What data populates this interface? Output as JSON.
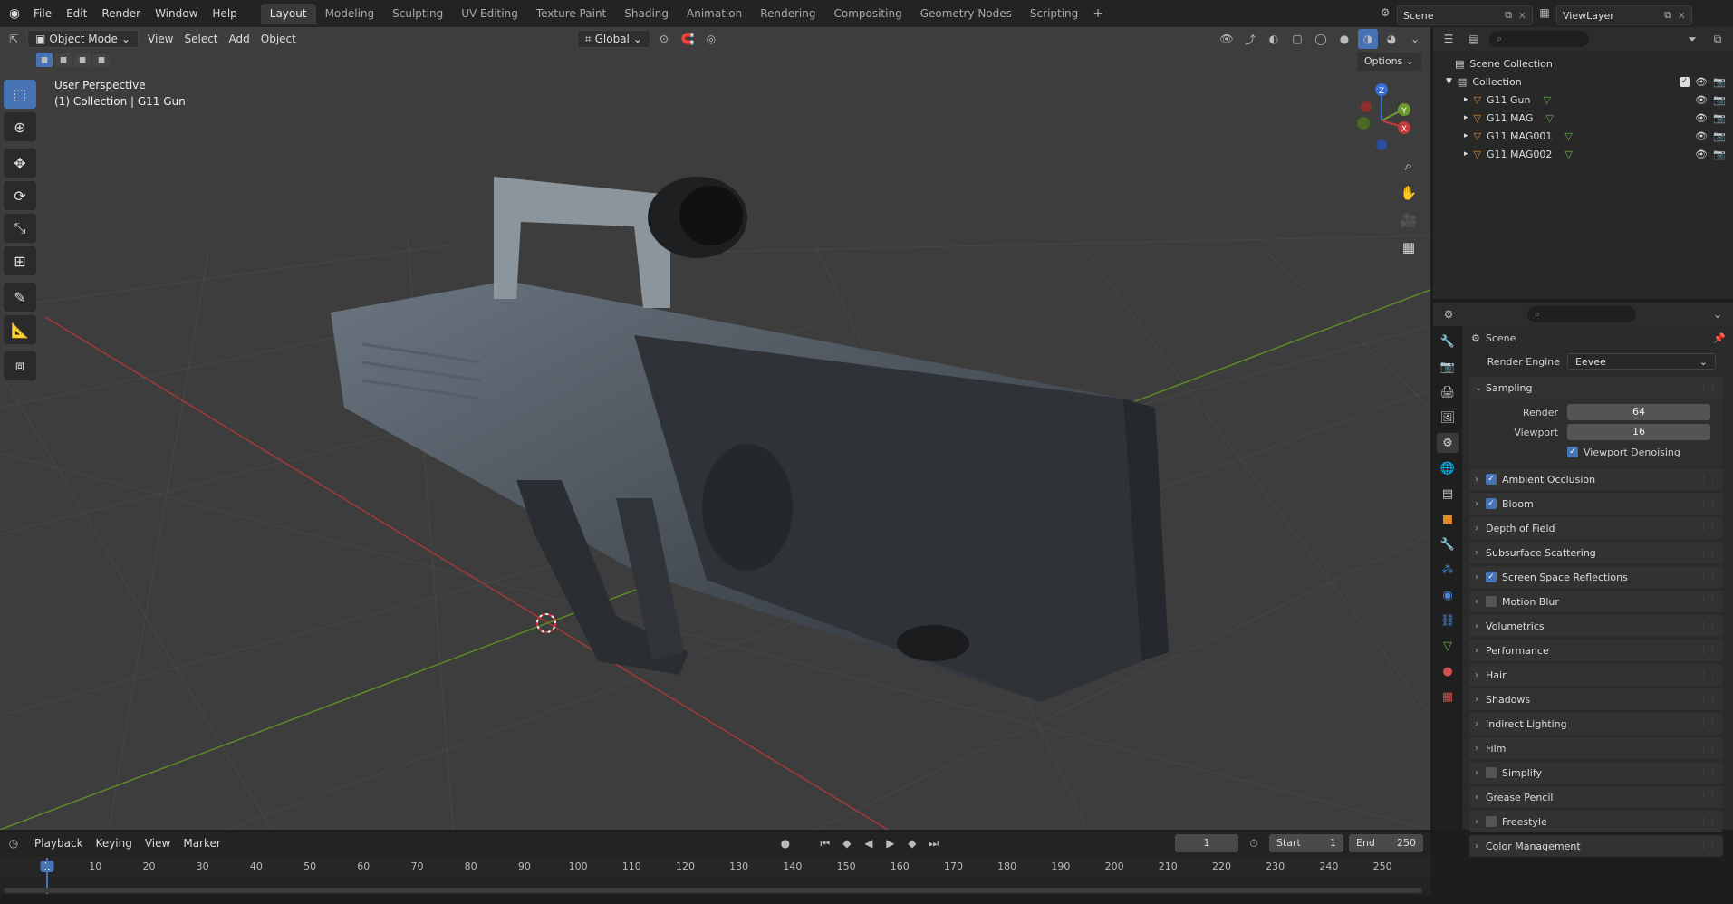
{
  "menubar": {
    "items": [
      "File",
      "Edit",
      "Render",
      "Window",
      "Help"
    ]
  },
  "workspaces": {
    "tabs": [
      "Layout",
      "Modeling",
      "Sculpting",
      "UV Editing",
      "Texture Paint",
      "Shading",
      "Animation",
      "Rendering",
      "Compositing",
      "Geometry Nodes",
      "Scripting"
    ],
    "active": "Layout",
    "add_label": "+"
  },
  "scene": {
    "label": "Scene"
  },
  "viewlayer": {
    "label": "ViewLayer"
  },
  "viewport": {
    "mode": "Object Mode",
    "menus": [
      "View",
      "Select",
      "Add",
      "Object"
    ],
    "transform_orientation": "Global",
    "options_label": "Options",
    "overlay_text": {
      "line1": "User Perspective",
      "line2": "(1) Collection | G11 Gun"
    },
    "gizmo": {
      "z": "Z",
      "y": "Y",
      "x": "X"
    }
  },
  "outliner": {
    "search_placeholder": "",
    "scene_collection": "Scene Collection",
    "collection": "Collection",
    "objects": [
      "G11 Gun",
      "G11 MAG",
      "G11 MAG001",
      "G11 MAG002"
    ]
  },
  "properties": {
    "context_label": "Scene",
    "render_engine_label": "Render Engine",
    "render_engine_value": "Eevee",
    "sampling": {
      "title": "Sampling",
      "render_label": "Render",
      "render_value": "64",
      "viewport_label": "Viewport",
      "viewport_value": "16",
      "denoise_label": "Viewport Denoising"
    },
    "panels": [
      {
        "label": "Ambient Occlusion",
        "checkbox": "on"
      },
      {
        "label": "Bloom",
        "checkbox": "on"
      },
      {
        "label": "Depth of Field",
        "checkbox": "none"
      },
      {
        "label": "Subsurface Scattering",
        "checkbox": "none"
      },
      {
        "label": "Screen Space Reflections",
        "checkbox": "on"
      },
      {
        "label": "Motion Blur",
        "checkbox": "off"
      },
      {
        "label": "Volumetrics",
        "checkbox": "none"
      },
      {
        "label": "Performance",
        "checkbox": "none"
      },
      {
        "label": "Hair",
        "checkbox": "none"
      },
      {
        "label": "Shadows",
        "checkbox": "none"
      },
      {
        "label": "Indirect Lighting",
        "checkbox": "none"
      },
      {
        "label": "Film",
        "checkbox": "none"
      },
      {
        "label": "Simplify",
        "checkbox": "off"
      },
      {
        "label": "Grease Pencil",
        "checkbox": "none"
      },
      {
        "label": "Freestyle",
        "checkbox": "off"
      },
      {
        "label": "Color Management",
        "checkbox": "none"
      }
    ]
  },
  "timeline": {
    "menus": [
      "Playback",
      "Keying",
      "View",
      "Marker"
    ],
    "current_frame": "1",
    "start_label": "Start",
    "start_value": "1",
    "end_label": "End",
    "end_value": "250",
    "ticks": [
      "1",
      "10",
      "20",
      "30",
      "40",
      "50",
      "60",
      "70",
      "80",
      "90",
      "100",
      "110",
      "120",
      "130",
      "140",
      "150",
      "160",
      "170",
      "180",
      "190",
      "200",
      "210",
      "220",
      "230",
      "240",
      "250"
    ]
  },
  "colors": {
    "accent": "#4772b3",
    "x_axis": "#c23a3a",
    "y_axis": "#6e9a2c",
    "z_axis": "#3b6fd6"
  }
}
